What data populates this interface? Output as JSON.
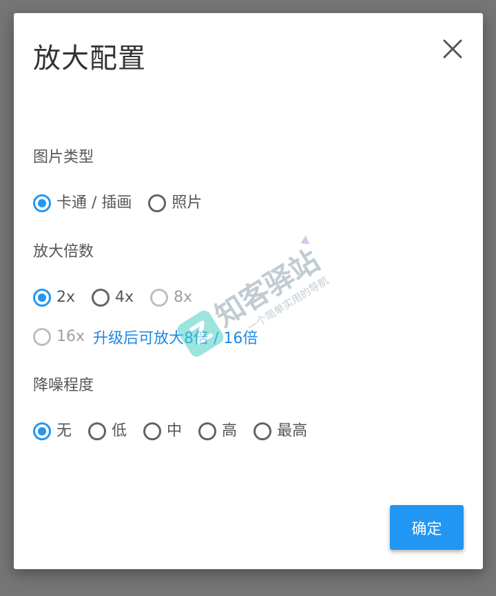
{
  "dialog": {
    "title": "放大配置",
    "confirm_label": "确定"
  },
  "image_type": {
    "label": "图片类型",
    "options": [
      {
        "label": "卡通 / 插画",
        "checked": true
      },
      {
        "label": "照片",
        "checked": false
      }
    ]
  },
  "scale": {
    "label": "放大倍数",
    "options": [
      {
        "label": "2x",
        "checked": true,
        "disabled": false
      },
      {
        "label": "4x",
        "checked": false,
        "disabled": false
      },
      {
        "label": "8x",
        "checked": false,
        "disabled": true
      },
      {
        "label": "16x",
        "checked": false,
        "disabled": true
      }
    ],
    "upgrade_text": "升级后可放大8倍 / 16倍"
  },
  "denoise": {
    "label": "降噪程度",
    "options": [
      {
        "label": "无",
        "checked": true
      },
      {
        "label": "低",
        "checked": false
      },
      {
        "label": "中",
        "checked": false
      },
      {
        "label": "高",
        "checked": false
      },
      {
        "label": "最高",
        "checked": false
      }
    ]
  },
  "watermark": {
    "brand": "知客驿站",
    "slogan": "一个简单实用的导航"
  },
  "colors": {
    "accent": "#2196f3",
    "link": "#1e88e5",
    "overlay": "#757575"
  },
  "icons": {
    "close": "close-icon",
    "radio_checked": "radio-checked-icon",
    "radio_unchecked": "radio-unchecked-icon"
  }
}
